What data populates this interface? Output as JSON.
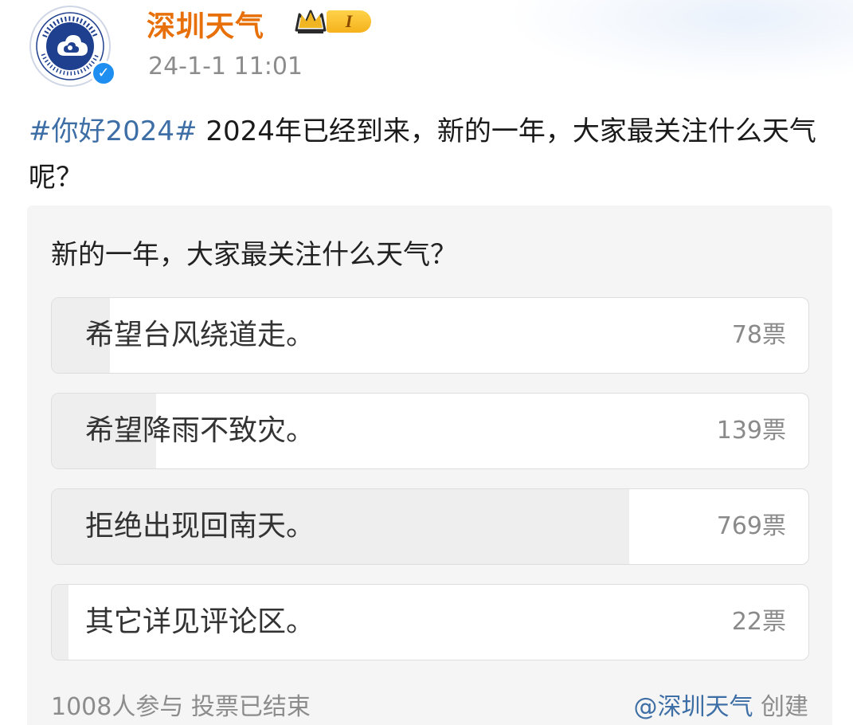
{
  "author": {
    "name": "深圳天气",
    "level": "I",
    "timestamp": "24-1-1 11:01",
    "avatar_icon": "meteorological-bureau-logo",
    "verified_icon": "verified-badge-icon",
    "level_icon": "crown-icon"
  },
  "post": {
    "hashtag": "#你好2024#",
    "text": " 2024年已经到来，新的一年，大家最关注什么天气呢？"
  },
  "poll": {
    "question": "新的一年，大家最关注什么天气？",
    "options": [
      {
        "label": "希望台风绕道走。",
        "votes_text": "78票",
        "votes": 78,
        "share": 0.077
      },
      {
        "label": "希望降雨不致灾。",
        "votes_text": "139票",
        "votes": 139,
        "share": 0.138
      },
      {
        "label": "拒绝出现回南天。",
        "votes_text": "769票",
        "votes": 769,
        "share": 0.763
      },
      {
        "label": "其它详见评论区。",
        "votes_text": "22票",
        "votes": 22,
        "share": 0.022
      }
    ],
    "participants": "1008人参与",
    "status": "投票已结束",
    "creator": "@深圳天气",
    "creator_suffix": " 创建"
  },
  "colors": {
    "author_name": "#e8700a",
    "hashtag": "#3d6ea5",
    "verified": "#1e8ff0",
    "poll_fill": "#eeeeee",
    "logo_blue": "#1f3f8f"
  }
}
